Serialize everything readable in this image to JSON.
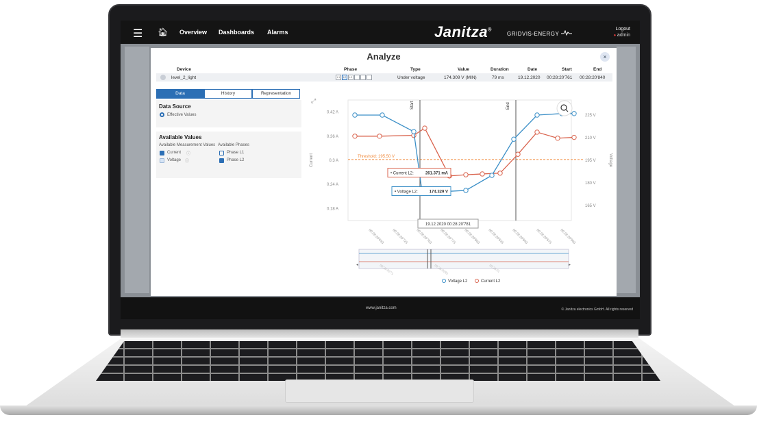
{
  "topbar": {
    "nav": [
      "Overview",
      "Dashboards",
      "Alarms"
    ],
    "brand": "Janitza",
    "brand_mark": "®",
    "subbrand": "GRIDVIS-ENERGY",
    "logout": "Logout",
    "user": "admin"
  },
  "modal": {
    "title": "Analyze",
    "close": "×",
    "table_headers": {
      "device": "Device",
      "phase": "Phase",
      "type": "Type",
      "value": "Value",
      "duration": "Duration",
      "date": "Date",
      "start": "Start",
      "end": "End"
    },
    "row": {
      "device": "level_2_light",
      "phase_boxes": [
        "L1",
        "L2",
        "L3",
        "L1-L2",
        "L2-L3",
        "L3-L1"
      ],
      "selected_phase": "L2",
      "type": "Under voltage",
      "value": "174.309 V (MIN)",
      "duration": "79 ms",
      "date": "19.12.2020",
      "start": "00:28:20'761",
      "end": "00:28:20'840"
    },
    "tabs": [
      "Data",
      "History",
      "Representation"
    ],
    "active_tab": "Data",
    "data_source": {
      "title": "Data Source",
      "option": "Effective Values"
    },
    "available_values": {
      "title": "Available Values",
      "measurement_label": "Available Measurement Values",
      "phases_label": "Available Phases",
      "measurements": [
        {
          "label": "Current",
          "checked": true
        },
        {
          "label": "Voltage",
          "checked": true
        }
      ],
      "phases": [
        {
          "label": "Phase L1",
          "checked": false
        },
        {
          "label": "Phase L2",
          "checked": true
        }
      ]
    }
  },
  "footer": {
    "url": "www.janitza.com",
    "copyright": "© Janitza electronics GmbH. All rights reserved"
  },
  "colors": {
    "voltage": "#3b8fc7",
    "current": "#d9634d",
    "threshold": "#f08a3c",
    "accent": "#2c6fb5"
  },
  "icons": [
    "menu-icon",
    "home-icon",
    "close-icon",
    "zoom-out-icon",
    "expand-icon",
    "info-icon"
  ],
  "chart_data": {
    "type": "line",
    "ylabel_left": "Current",
    "ylabel_right": "Voltage",
    "y_left_ticks": [
      "0.42 A",
      "0.36 A",
      "0.3 A",
      "0.24 A",
      "0.18 A"
    ],
    "y_right_ticks": [
      "225 V",
      "210 V",
      "195 V",
      "180 V",
      "165 V"
    ],
    "x_ticks": [
      "00:28:20'690",
      "00:28:20'725",
      "00:28:20'760",
      "00:28:20'775",
      "00:28:20'800",
      "00:28:20'835",
      "00:28:20'840",
      "00:28:20'875",
      "00:28:20'900"
    ],
    "threshold_label": "Threshold: 195.50 V",
    "threshold_value": 195.5,
    "start_label": "Start",
    "end_label": "End",
    "series": [
      {
        "name": "Voltage L2",
        "unit": "V",
        "values": [
          225,
          225,
          214,
          174.3,
          174.3,
          175,
          185,
          209,
          225,
          226,
          226
        ]
      },
      {
        "name": "Current L2",
        "unit": "A",
        "values": [
          0.36,
          0.36,
          0.362,
          0.38,
          0.261,
          0.264,
          0.266,
          0.268,
          0.315,
          0.37,
          0.355,
          0.357
        ]
      }
    ],
    "tooltips": {
      "current": {
        "label": "Current L2:",
        "value": "261.371 mA"
      },
      "voltage": {
        "label": "Voltage L2:",
        "value": "174.329 V"
      },
      "time": "19.12.2020 00:28:20'781"
    },
    "navigator_ticks": [
      "00:28:20'71",
      "00:28:20'81",
      "00:28:21"
    ]
  }
}
